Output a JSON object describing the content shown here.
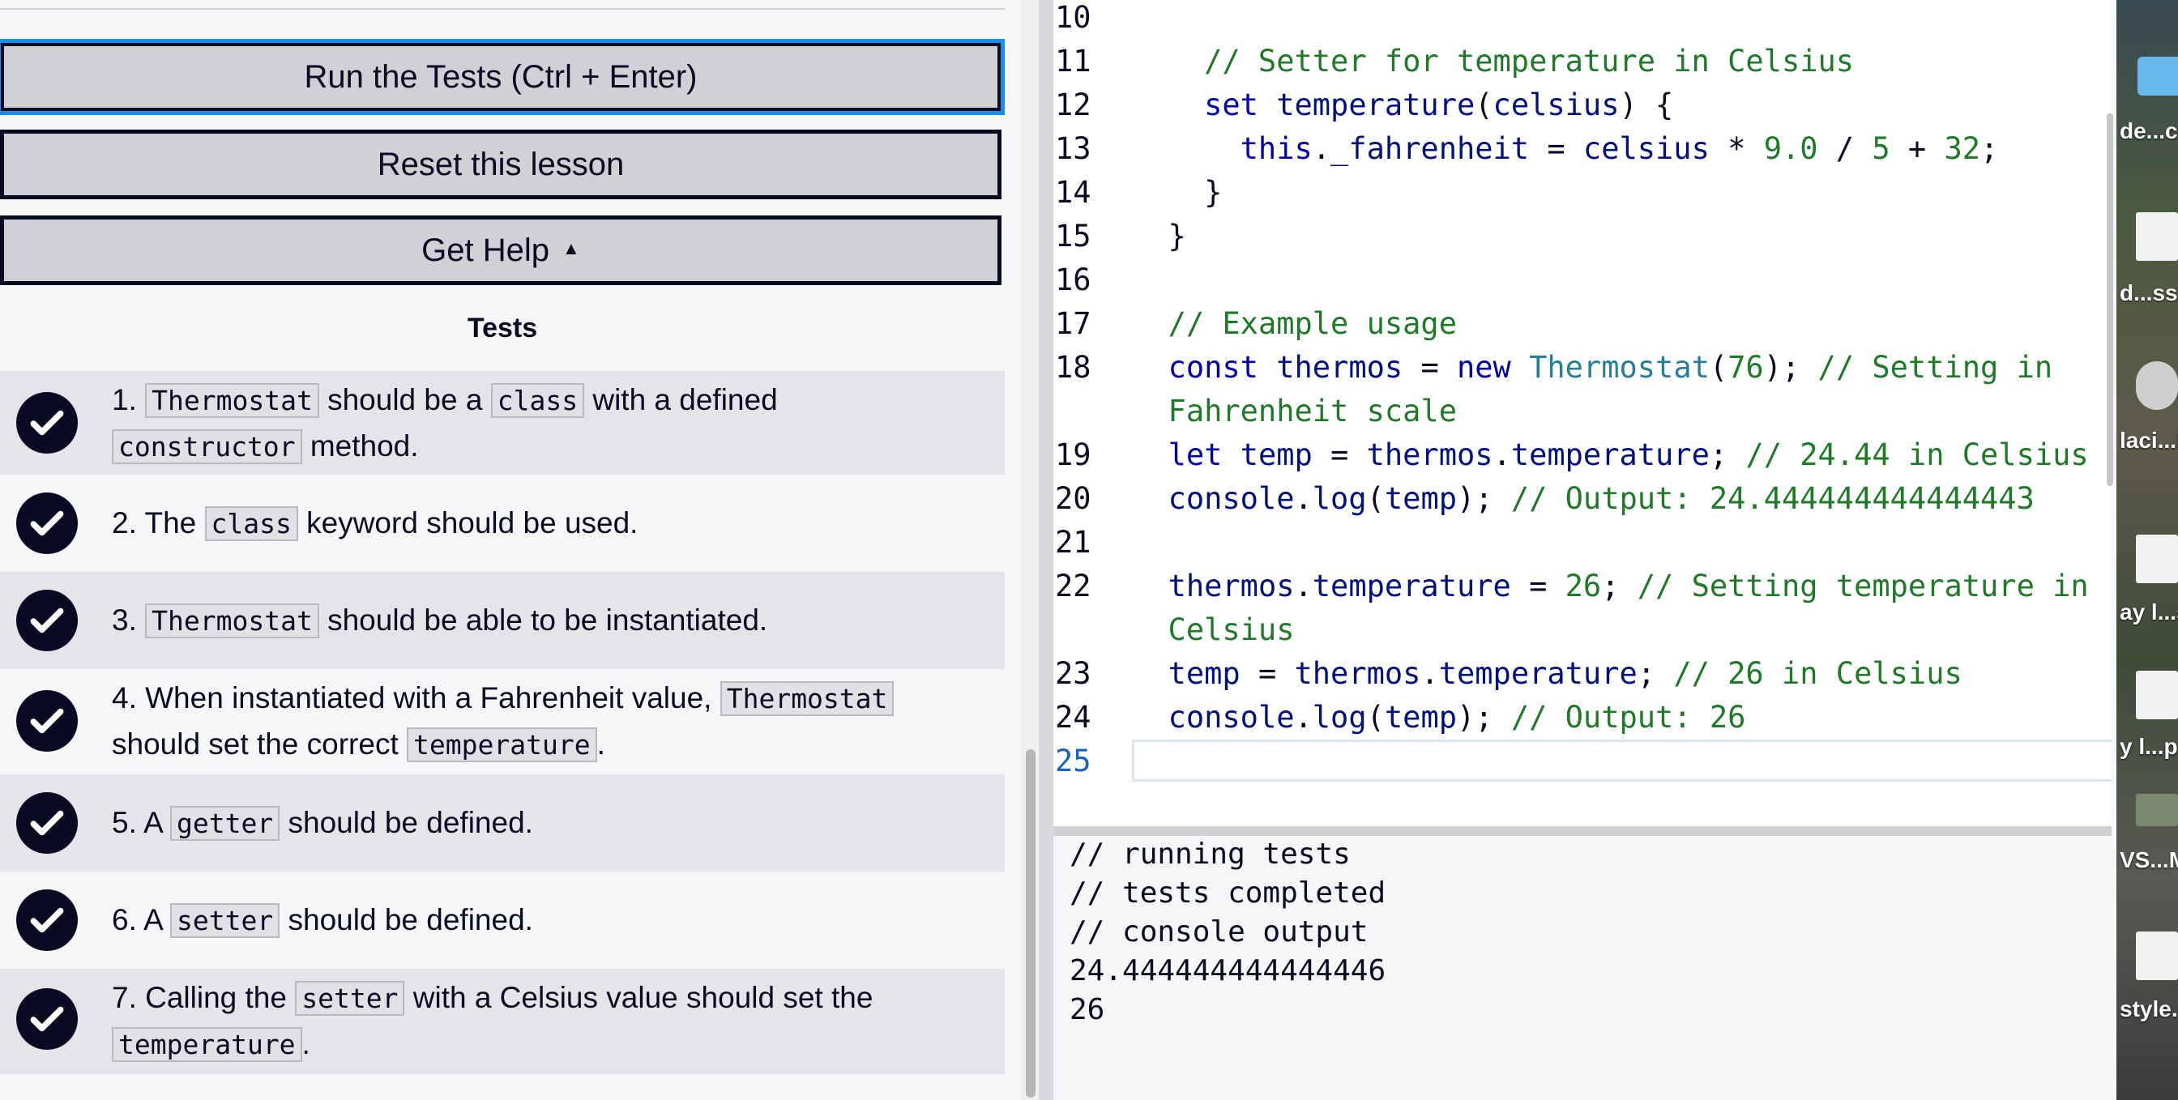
{
  "buttons": {
    "run": "Run the Tests (Ctrl + Enter)",
    "reset": "Reset this lesson",
    "help": "Get Help",
    "help_caret": "▲"
  },
  "tests": {
    "heading": "Tests",
    "items": [
      {
        "parts": [
          "1. ",
          "Thermostat",
          " should be a ",
          "class",
          " with a defined ",
          "constructor",
          " method."
        ]
      },
      {
        "parts": [
          "2. The ",
          "class",
          " keyword should be used."
        ]
      },
      {
        "parts": [
          "3. ",
          "Thermostat",
          " should be able to be instantiated."
        ]
      },
      {
        "parts": [
          "4. When instantiated with a Fahrenheit value, ",
          "Thermostat",
          " should set the correct ",
          "temperature",
          "."
        ]
      },
      {
        "parts": [
          "5. A ",
          "getter",
          " should be defined."
        ]
      },
      {
        "parts": [
          "6. A ",
          "setter",
          " should be defined."
        ]
      },
      {
        "parts": [
          "7. Calling the ",
          "setter",
          " with a Celsius value should set the ",
          "temperature",
          "."
        ]
      }
    ]
  },
  "editor": {
    "lines": [
      {
        "n": "10",
        "t": ""
      },
      {
        "n": "11",
        "t": "    // Setter for temperature in Celsius"
      },
      {
        "n": "12",
        "t": "    set temperature(celsius) {"
      },
      {
        "n": "13",
        "t": "      this._fahrenheit = celsius * 9.0 / 5 + 32;"
      },
      {
        "n": "14",
        "t": "    }"
      },
      {
        "n": "15",
        "t": "  }"
      },
      {
        "n": "16",
        "t": ""
      },
      {
        "n": "17",
        "t": "  // Example usage"
      },
      {
        "n": "18",
        "t": "  const thermos = new Thermostat(76); // Setting in"
      },
      {
        "n": "",
        "t": "  Fahrenheit scale"
      },
      {
        "n": "19",
        "t": "  let temp = thermos.temperature; // 24.44 in Celsius"
      },
      {
        "n": "20",
        "t": "  console.log(temp); // Output: 24.444444444444443"
      },
      {
        "n": "21",
        "t": ""
      },
      {
        "n": "22",
        "t": "  thermos.temperature = 26; // Setting temperature in"
      },
      {
        "n": "",
        "t": "  Celsius"
      },
      {
        "n": "23",
        "t": "  temp = thermos.temperature; // 26 in Celsius"
      },
      {
        "n": "24",
        "t": "  console.log(temp); // Output: 26"
      },
      {
        "n": "25",
        "t": ""
      }
    ]
  },
  "console": {
    "lines": [
      "// running tests",
      "// tests completed",
      "// console output",
      "24.444444444444446",
      "26"
    ]
  },
  "desktop": {
    "labels": [
      "de...c",
      "d...ss",
      "laci...l",
      "ay l...s",
      "y l...p",
      "VS...M",
      "style..."
    ]
  },
  "colors": {
    "ink": "#0a0a23",
    "button_bg": "#d0d0d5",
    "focus": "#198eee",
    "comment": "#1e7a27",
    "keyword": "#0000aa"
  }
}
